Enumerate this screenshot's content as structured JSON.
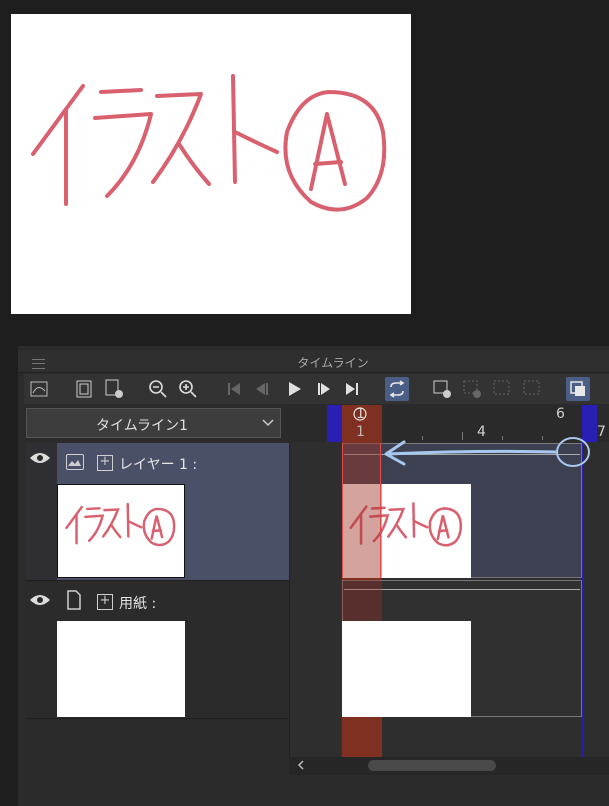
{
  "canvas": {
    "drawing_text": "イラスト",
    "circled_letter": "A",
    "stroke_color": "#d9606e"
  },
  "window": {
    "title": "タイムライン"
  },
  "toolbar": {
    "icons": [
      "curve-icon",
      "filmstrip-icon",
      "new-film-icon",
      "zoom-out-icon",
      "zoom-in-icon",
      "first-frame-icon",
      "prev-frame-icon",
      "play-icon",
      "next-frame-icon",
      "last-frame-icon",
      "loop-icon",
      "new-cel-icon",
      "cel-add-icon",
      "cel-link-icon",
      "cel-delete-icon",
      "onion-skin-icon"
    ]
  },
  "timeline_selector": {
    "value": "タイムライン1"
  },
  "layers": [
    {
      "name": "レイヤー 1 :",
      "type": "raster"
    },
    {
      "name": "用紙 :",
      "type": "paper"
    }
  ],
  "ruler": {
    "top_labels": [
      "1",
      "6"
    ],
    "bottom_labels": [
      "1",
      "4",
      "7"
    ],
    "current_frame": "1"
  },
  "colors": {
    "accent_blue": "#2a1fb5",
    "current_frame": "#803020",
    "selected_row": "#4a5068",
    "arrow": "#a9c8f0"
  }
}
